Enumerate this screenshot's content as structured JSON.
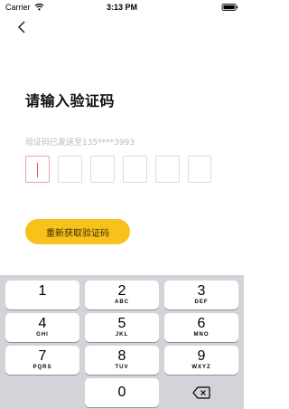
{
  "status_bar": {
    "carrier": "Carrier",
    "time": "3:13 PM"
  },
  "icons": {
    "back": "chevron-left-icon",
    "wifi": "wifi-icon",
    "battery": "battery-icon",
    "delete": "backspace-icon"
  },
  "page": {
    "title": "请输入验证码",
    "sent_hint": "验证码已发送至135****3993",
    "resend_button": "重新获取验证码"
  },
  "code_input": {
    "length": 6,
    "values": [
      "",
      "",
      "",
      "",
      "",
      ""
    ],
    "active_index": 0
  },
  "keypad": {
    "keys": [
      {
        "digit": "1",
        "letters": ""
      },
      {
        "digit": "2",
        "letters": "ABC"
      },
      {
        "digit": "3",
        "letters": "DEF"
      },
      {
        "digit": "4",
        "letters": "GHI"
      },
      {
        "digit": "5",
        "letters": "JKL"
      },
      {
        "digit": "6",
        "letters": "MNO"
      },
      {
        "digit": "7",
        "letters": "PQRS"
      },
      {
        "digit": "8",
        "letters": "TUV"
      },
      {
        "digit": "9",
        "letters": "WXYZ"
      },
      {
        "digit": "0",
        "letters": ""
      }
    ]
  },
  "colors": {
    "accent": "#f7c21b",
    "cursor": "#e05252",
    "keyboard_bg": "#d2d4d9"
  }
}
